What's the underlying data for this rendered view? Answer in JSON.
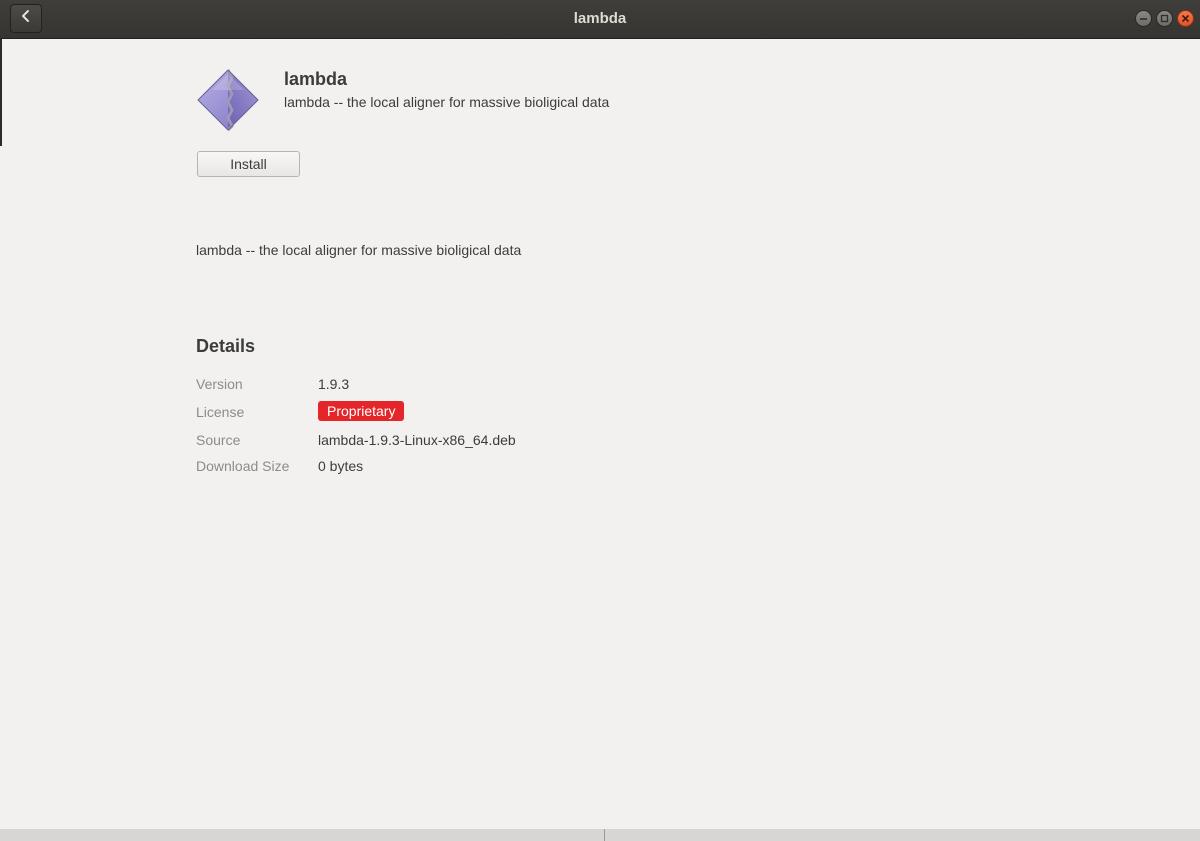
{
  "window": {
    "title": "lambda"
  },
  "app": {
    "name": "lambda",
    "summary": "lambda -- the local aligner for massive bioligical data",
    "icon": "package-diamond-icon",
    "install_label": "Install",
    "description": "lambda -- the local aligner for massive bioligical data"
  },
  "details": {
    "heading": "Details",
    "version_label": "Version",
    "version_value": "1.9.3",
    "license_label": "License",
    "license_value": "Proprietary",
    "source_label": "Source",
    "source_value": "lambda-1.9.3-Linux-x86_64.deb",
    "download_size_label": "Download Size",
    "download_size_value": "0 bytes"
  },
  "colors": {
    "license_badge": "#e4262a",
    "titlebar": "#3a3936",
    "background": "#f2f1f0",
    "close_button": "#e9622f"
  }
}
